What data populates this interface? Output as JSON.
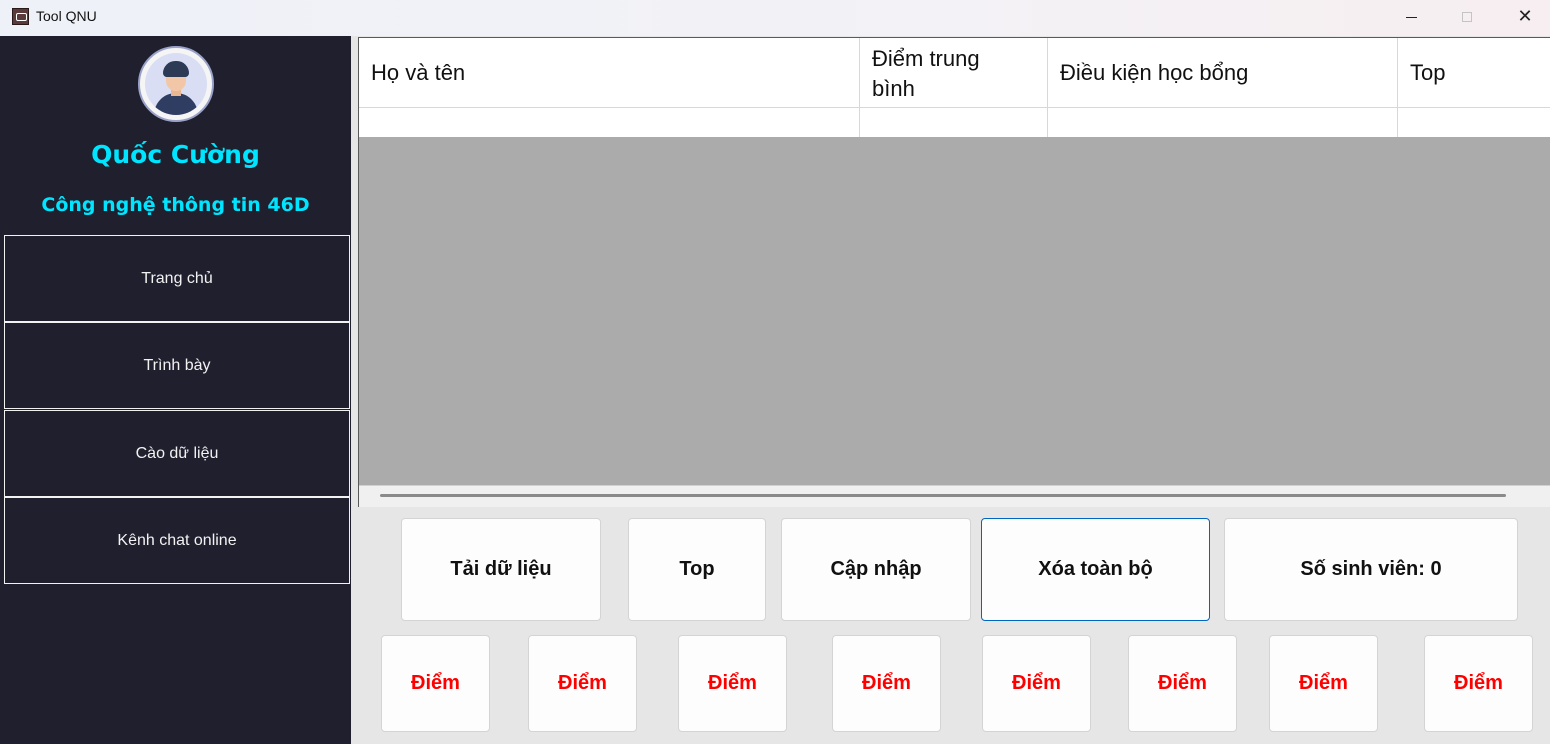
{
  "window": {
    "title": "Tool QNU",
    "minimize_icon": "minimize-icon",
    "maximize_icon": "maximize-icon",
    "close_glyph": "✕"
  },
  "sidebar": {
    "user_name": "Quốc Cường",
    "user_class": "Công nghệ thông tin 46D",
    "items": [
      {
        "label": "Trang chủ"
      },
      {
        "label": "Trình bày"
      },
      {
        "label": "Cào dữ liệu"
      },
      {
        "label": "Kênh chat online"
      }
    ]
  },
  "table": {
    "columns": [
      {
        "label": "Họ và tên"
      },
      {
        "label": "Điểm trung bình"
      },
      {
        "label": "Điều kiện học bổng"
      },
      {
        "label": "Top"
      }
    ],
    "rows": [
      [
        "",
        "",
        "",
        ""
      ]
    ]
  },
  "actions": {
    "load": "Tải dữ liệu",
    "top": "Top",
    "update": "Cập nhập",
    "clear_all": "Xóa toàn bộ",
    "student_count": "Số sinh viên: 0"
  },
  "score_buttons": [
    {
      "label": "Điểm"
    },
    {
      "label": "Điểm"
    },
    {
      "label": "Điểm"
    },
    {
      "label": "Điểm"
    },
    {
      "label": "Điểm"
    },
    {
      "label": "Điểm"
    },
    {
      "label": "Điểm"
    },
    {
      "label": "Điểm"
    }
  ],
  "colors": {
    "sidebar_bg": "#1f1f2e",
    "accent_cyan": "#00e5ff",
    "score_red": "#ff0000",
    "focus_blue": "#0067c0"
  }
}
